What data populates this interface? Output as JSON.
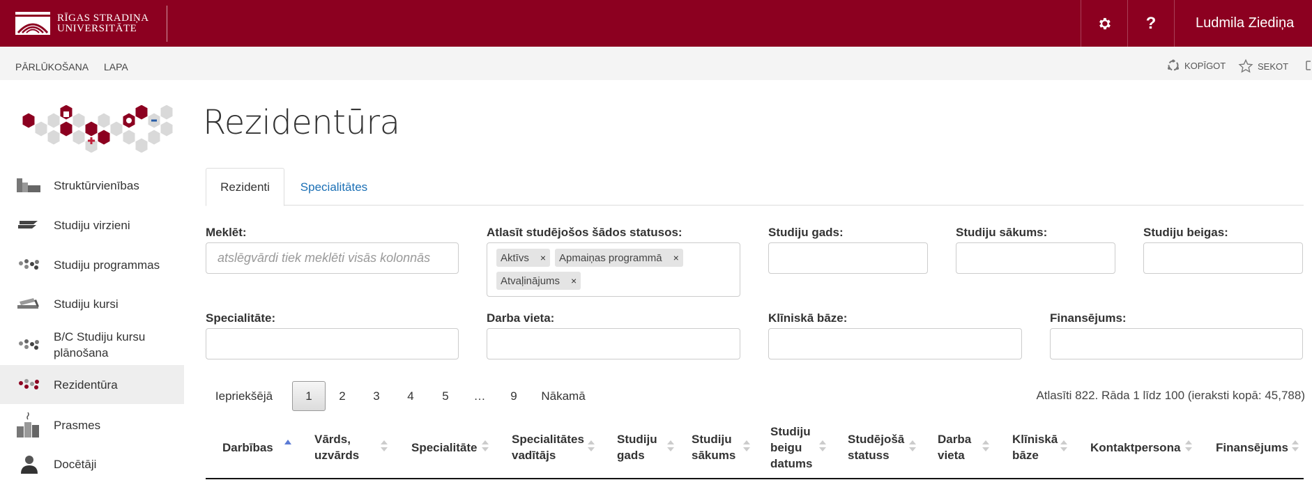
{
  "header": {
    "logo_line1": "RĪGAS STRADIŅA",
    "logo_line2": "UNIVERSITĀTE",
    "help_label": "?",
    "user_name": "Ludmila Ziediņa"
  },
  "ribbon": {
    "tabs": [
      "PĀRLŪKOŠANA",
      "LAPA"
    ],
    "share_label": "KOPĪGOT",
    "follow_label": "SEKOT"
  },
  "sidebar": {
    "items": [
      {
        "label": "Struktūrvienības",
        "icon": "building-icon"
      },
      {
        "label": "Studiju virzieni",
        "icon": "stack-icon"
      },
      {
        "label": "Studiju programmas",
        "icon": "molecule-icon"
      },
      {
        "label": "Studiju kursi",
        "icon": "books-icon"
      },
      {
        "label": "B/C Studiju kursu plānošana",
        "icon": "molecule-icon"
      },
      {
        "label": "Rezidentūra",
        "icon": "molecule-red-icon",
        "active": true
      },
      {
        "label": "Prasmes",
        "icon": "steps-icon"
      },
      {
        "label": "Docētāji",
        "icon": "person-icon"
      }
    ]
  },
  "page": {
    "title": "Rezidentūra",
    "tabs": [
      "Rezidenti",
      "Specialitātes"
    ]
  },
  "filters": {
    "search_label": "Meklēt:",
    "search_placeholder": "atslēgvārdi tiek meklēti visās kolonnās",
    "status_label": "Atlasīt studējošos šādos statusos:",
    "status_tags": [
      "Aktīvs",
      "Apmaiņas programmā",
      "Atvaļinājums"
    ],
    "year_label": "Studiju gads:",
    "start_label": "Studiju sākums:",
    "end_label": "Studiju beigas:",
    "specialty_label": "Specialitāte:",
    "workplace_label": "Darba vieta:",
    "clinic_label": "Klīniskā bāze:",
    "funding_label": "Finansējums:"
  },
  "pagination": {
    "prev": "Iepriekšējā",
    "pages": [
      "1",
      "2",
      "3",
      "4",
      "5",
      "…",
      "9"
    ],
    "current": "1",
    "next": "Nākamā",
    "info": "Atlasīti 822. Rāda 1 līdz 100 (ieraksti kopā: 45,788)"
  },
  "table": {
    "columns": [
      "Darbības",
      "Vārds, uzvārds",
      "Specialitāte",
      "Specialitātes vadītājs",
      "Studiju gads",
      "Studiju sākums",
      "Studiju beigu datums",
      "Studējošā statuss",
      "Darba vieta",
      "Klīniskā bāze",
      "Kontaktpersona",
      "Finansējums"
    ]
  },
  "colors": {
    "brand": "#8c0020",
    "link": "#1a6fb5",
    "sort_active": "#5b7bd5"
  }
}
